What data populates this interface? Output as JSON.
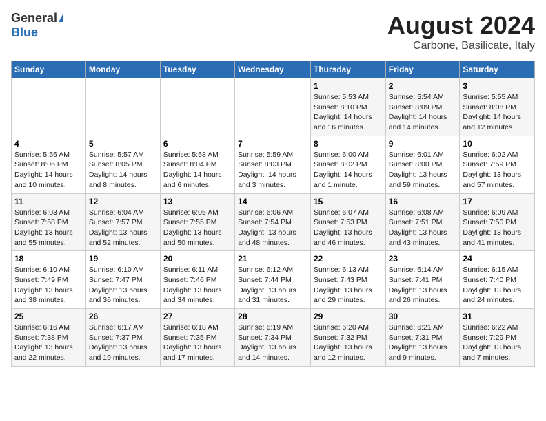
{
  "header": {
    "logo_general": "General",
    "logo_blue": "Blue",
    "title": "August 2024",
    "subtitle": "Carbone, Basilicate, Italy"
  },
  "days_of_week": [
    "Sunday",
    "Monday",
    "Tuesday",
    "Wednesday",
    "Thursday",
    "Friday",
    "Saturday"
  ],
  "weeks": [
    {
      "days": [
        {
          "number": "",
          "content": ""
        },
        {
          "number": "",
          "content": ""
        },
        {
          "number": "",
          "content": ""
        },
        {
          "number": "",
          "content": ""
        },
        {
          "number": "1",
          "content": "Sunrise: 5:53 AM\nSunset: 8:10 PM\nDaylight: 14 hours and 16 minutes."
        },
        {
          "number": "2",
          "content": "Sunrise: 5:54 AM\nSunset: 8:09 PM\nDaylight: 14 hours and 14 minutes."
        },
        {
          "number": "3",
          "content": "Sunrise: 5:55 AM\nSunset: 8:08 PM\nDaylight: 14 hours and 12 minutes."
        }
      ]
    },
    {
      "days": [
        {
          "number": "4",
          "content": "Sunrise: 5:56 AM\nSunset: 8:06 PM\nDaylight: 14 hours and 10 minutes."
        },
        {
          "number": "5",
          "content": "Sunrise: 5:57 AM\nSunset: 8:05 PM\nDaylight: 14 hours and 8 minutes."
        },
        {
          "number": "6",
          "content": "Sunrise: 5:58 AM\nSunset: 8:04 PM\nDaylight: 14 hours and 6 minutes."
        },
        {
          "number": "7",
          "content": "Sunrise: 5:59 AM\nSunset: 8:03 PM\nDaylight: 14 hours and 3 minutes."
        },
        {
          "number": "8",
          "content": "Sunrise: 6:00 AM\nSunset: 8:02 PM\nDaylight: 14 hours and 1 minute."
        },
        {
          "number": "9",
          "content": "Sunrise: 6:01 AM\nSunset: 8:00 PM\nDaylight: 13 hours and 59 minutes."
        },
        {
          "number": "10",
          "content": "Sunrise: 6:02 AM\nSunset: 7:59 PM\nDaylight: 13 hours and 57 minutes."
        }
      ]
    },
    {
      "days": [
        {
          "number": "11",
          "content": "Sunrise: 6:03 AM\nSunset: 7:58 PM\nDaylight: 13 hours and 55 minutes."
        },
        {
          "number": "12",
          "content": "Sunrise: 6:04 AM\nSunset: 7:57 PM\nDaylight: 13 hours and 52 minutes."
        },
        {
          "number": "13",
          "content": "Sunrise: 6:05 AM\nSunset: 7:55 PM\nDaylight: 13 hours and 50 minutes."
        },
        {
          "number": "14",
          "content": "Sunrise: 6:06 AM\nSunset: 7:54 PM\nDaylight: 13 hours and 48 minutes."
        },
        {
          "number": "15",
          "content": "Sunrise: 6:07 AM\nSunset: 7:53 PM\nDaylight: 13 hours and 46 minutes."
        },
        {
          "number": "16",
          "content": "Sunrise: 6:08 AM\nSunset: 7:51 PM\nDaylight: 13 hours and 43 minutes."
        },
        {
          "number": "17",
          "content": "Sunrise: 6:09 AM\nSunset: 7:50 PM\nDaylight: 13 hours and 41 minutes."
        }
      ]
    },
    {
      "days": [
        {
          "number": "18",
          "content": "Sunrise: 6:10 AM\nSunset: 7:49 PM\nDaylight: 13 hours and 38 minutes."
        },
        {
          "number": "19",
          "content": "Sunrise: 6:10 AM\nSunset: 7:47 PM\nDaylight: 13 hours and 36 minutes."
        },
        {
          "number": "20",
          "content": "Sunrise: 6:11 AM\nSunset: 7:46 PM\nDaylight: 13 hours and 34 minutes."
        },
        {
          "number": "21",
          "content": "Sunrise: 6:12 AM\nSunset: 7:44 PM\nDaylight: 13 hours and 31 minutes."
        },
        {
          "number": "22",
          "content": "Sunrise: 6:13 AM\nSunset: 7:43 PM\nDaylight: 13 hours and 29 minutes."
        },
        {
          "number": "23",
          "content": "Sunrise: 6:14 AM\nSunset: 7:41 PM\nDaylight: 13 hours and 26 minutes."
        },
        {
          "number": "24",
          "content": "Sunrise: 6:15 AM\nSunset: 7:40 PM\nDaylight: 13 hours and 24 minutes."
        }
      ]
    },
    {
      "days": [
        {
          "number": "25",
          "content": "Sunrise: 6:16 AM\nSunset: 7:38 PM\nDaylight: 13 hours and 22 minutes."
        },
        {
          "number": "26",
          "content": "Sunrise: 6:17 AM\nSunset: 7:37 PM\nDaylight: 13 hours and 19 minutes."
        },
        {
          "number": "27",
          "content": "Sunrise: 6:18 AM\nSunset: 7:35 PM\nDaylight: 13 hours and 17 minutes."
        },
        {
          "number": "28",
          "content": "Sunrise: 6:19 AM\nSunset: 7:34 PM\nDaylight: 13 hours and 14 minutes."
        },
        {
          "number": "29",
          "content": "Sunrise: 6:20 AM\nSunset: 7:32 PM\nDaylight: 13 hours and 12 minutes."
        },
        {
          "number": "30",
          "content": "Sunrise: 6:21 AM\nSunset: 7:31 PM\nDaylight: 13 hours and 9 minutes."
        },
        {
          "number": "31",
          "content": "Sunrise: 6:22 AM\nSunset: 7:29 PM\nDaylight: 13 hours and 7 minutes."
        }
      ]
    }
  ]
}
